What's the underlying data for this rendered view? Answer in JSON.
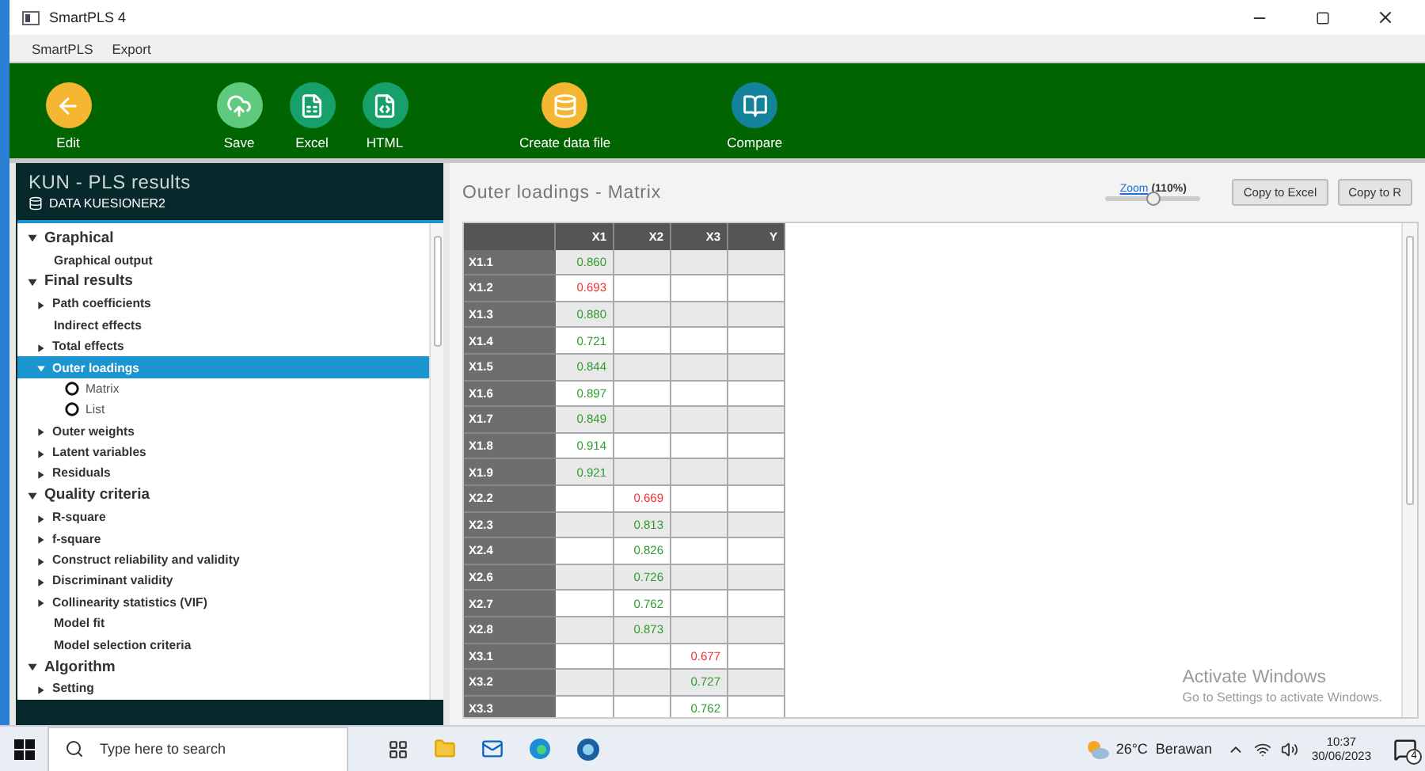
{
  "window": {
    "title": "SmartPLS 4"
  },
  "menu": [
    "SmartPLS",
    "Export"
  ],
  "toolbar": [
    {
      "label": "Edit",
      "color": "#f5b731"
    },
    {
      "label": "Save",
      "color": "#5fc97e"
    },
    {
      "label": "Excel",
      "color": "#17a06a"
    },
    {
      "label": "HTML",
      "color": "#17a06a"
    },
    {
      "label": "Create data file",
      "color": "#f5b731"
    },
    {
      "label": "Compare",
      "color": "#12839a"
    }
  ],
  "project": {
    "title": "KUN - PLS results",
    "dataset": "DATA KUESIONER2"
  },
  "tree": [
    {
      "kind": "group",
      "label": "Graphical",
      "expanded": true,
      "children": [
        {
          "kind": "leaf",
          "label": "Graphical output",
          "selected": false
        }
      ]
    },
    {
      "kind": "group",
      "label": "Final results",
      "expanded": true,
      "children": [
        {
          "kind": "branch",
          "label": "Path coefficients",
          "expanded": false,
          "selected": false
        },
        {
          "kind": "leaf",
          "label": "Indirect effects",
          "selected": false
        },
        {
          "kind": "branch",
          "label": "Total effects",
          "expanded": false,
          "selected": false
        },
        {
          "kind": "branch",
          "label": "Outer loadings",
          "expanded": true,
          "selected": true,
          "children": [
            {
              "kind": "radio",
              "label": "Matrix",
              "selected": false
            },
            {
              "kind": "radio",
              "label": "List",
              "selected": false
            }
          ]
        },
        {
          "kind": "branch",
          "label": "Outer weights",
          "expanded": false,
          "selected": false
        },
        {
          "kind": "branch",
          "label": "Latent variables",
          "expanded": false,
          "selected": false
        },
        {
          "kind": "branch",
          "label": "Residuals",
          "expanded": false,
          "selected": false
        }
      ]
    },
    {
      "kind": "group",
      "label": "Quality criteria",
      "expanded": true,
      "children": [
        {
          "kind": "branch",
          "label": "R-square",
          "expanded": false,
          "selected": false
        },
        {
          "kind": "branch",
          "label": "f-square",
          "expanded": false,
          "selected": false
        },
        {
          "kind": "branch",
          "label": "Construct reliability and validity",
          "expanded": false,
          "selected": false
        },
        {
          "kind": "branch",
          "label": "Discriminant validity",
          "expanded": false,
          "selected": false
        },
        {
          "kind": "branch",
          "label": "Collinearity statistics (VIF)",
          "expanded": false,
          "selected": false
        },
        {
          "kind": "leaf",
          "label": "Model fit",
          "selected": false
        },
        {
          "kind": "leaf",
          "label": "Model selection criteria",
          "selected": false
        }
      ]
    },
    {
      "kind": "group",
      "label": "Algorithm",
      "expanded": true,
      "children": [
        {
          "kind": "branch",
          "label": "Setting",
          "expanded": false,
          "selected": false
        }
      ]
    }
  ],
  "results": {
    "title": "Outer loadings - Matrix",
    "zoom_link": "Zoom",
    "zoom_value": "(110%)",
    "zoom": {
      "level": 0.5
    },
    "buttons": [
      "Copy to Excel",
      "Copy to R"
    ]
  },
  "table": {
    "columns": [
      "X1",
      "X2",
      "X3",
      "Y"
    ],
    "rows": [
      {
        "label": "X1.1",
        "cells": [
          {
            "text": "0.860",
            "low": false
          },
          null,
          null,
          null
        ]
      },
      {
        "label": "X1.2",
        "cells": [
          {
            "text": "0.693",
            "low": true
          },
          null,
          null,
          null
        ]
      },
      {
        "label": "X1.3",
        "cells": [
          {
            "text": "0.880",
            "low": false
          },
          null,
          null,
          null
        ]
      },
      {
        "label": "X1.4",
        "cells": [
          {
            "text": "0.721",
            "low": false
          },
          null,
          null,
          null
        ]
      },
      {
        "label": "X1.5",
        "cells": [
          {
            "text": "0.844",
            "low": false
          },
          null,
          null,
          null
        ]
      },
      {
        "label": "X1.6",
        "cells": [
          {
            "text": "0.897",
            "low": false
          },
          null,
          null,
          null
        ]
      },
      {
        "label": "X1.7",
        "cells": [
          {
            "text": "0.849",
            "low": false
          },
          null,
          null,
          null
        ]
      },
      {
        "label": "X1.8",
        "cells": [
          {
            "text": "0.914",
            "low": false
          },
          null,
          null,
          null
        ]
      },
      {
        "label": "X1.9",
        "cells": [
          {
            "text": "0.921",
            "low": false
          },
          null,
          null,
          null
        ]
      },
      {
        "label": "X2.2",
        "cells": [
          null,
          {
            "text": "0.669",
            "low": true
          },
          null,
          null
        ]
      },
      {
        "label": "X2.3",
        "cells": [
          null,
          {
            "text": "0.813",
            "low": false
          },
          null,
          null
        ]
      },
      {
        "label": "X2.4",
        "cells": [
          null,
          {
            "text": "0.826",
            "low": false
          },
          null,
          null
        ]
      },
      {
        "label": "X2.6",
        "cells": [
          null,
          {
            "text": "0.726",
            "low": false
          },
          null,
          null
        ]
      },
      {
        "label": "X2.7",
        "cells": [
          null,
          {
            "text": "0.762",
            "low": false
          },
          null,
          null
        ]
      },
      {
        "label": "X2.8",
        "cells": [
          null,
          {
            "text": "0.873",
            "low": false
          },
          null,
          null
        ]
      },
      {
        "label": "X3.1",
        "cells": [
          null,
          null,
          {
            "text": "0.677",
            "low": true
          },
          null
        ]
      },
      {
        "label": "X3.2",
        "cells": [
          null,
          null,
          {
            "text": "0.727",
            "low": false
          },
          null
        ]
      },
      {
        "label": "X3.3",
        "cells": [
          null,
          null,
          {
            "text": "0.762",
            "low": false
          },
          null
        ]
      }
    ]
  },
  "activation": {
    "title": "Activate Windows",
    "subtitle": "Go to Settings to activate Windows."
  },
  "taskbar": {
    "search": {
      "placeholder": "Type here to search"
    },
    "weather": "26°C  Berawan",
    "time": "10:37",
    "date": "30/06/2023",
    "notifications": "4"
  }
}
